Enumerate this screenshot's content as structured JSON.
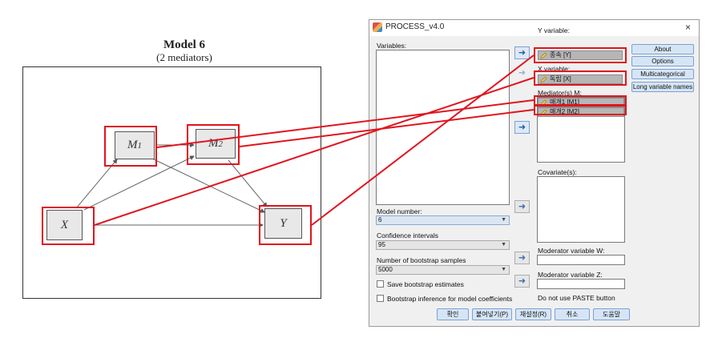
{
  "diagram": {
    "title": "Model 6",
    "subtitle": "(2 mediators)",
    "nodes": {
      "m1": {
        "base": "M",
        "sub": "1"
      },
      "m2": {
        "base": "M",
        "sub": "2"
      },
      "x": {
        "label": "X"
      },
      "y": {
        "label": "Y"
      }
    }
  },
  "dialog": {
    "title": "PROCESS_v4.0",
    "close_glyph": "×",
    "variables_label": "Variables:",
    "y_variable_label": "Y variable:",
    "y_variable_value": "종속 [Y]",
    "x_variable_label": "X variable:",
    "x_variable_value": "독립 [X]",
    "mediators_label": "Mediator(s) M:",
    "mediators": [
      "매개1 [M1]",
      "매개2 [M2]"
    ],
    "covariates_label": "Covariate(s):",
    "model_number_label": "Model number:",
    "model_number_value": "6",
    "confidence_label": "Confidence intervals",
    "confidence_value": "95",
    "bootstrap_label": "Number of bootstrap samples",
    "bootstrap_value": "5000",
    "save_bootstrap_label": "Save bootstrap estimates",
    "bootstrap_inference_label": "Bootstrap inference for model coefficients",
    "moderator_w_label": "Moderator variable W:",
    "moderator_z_label": "Moderator variable Z:",
    "paste_note": "Do not use PASTE button",
    "side_buttons": {
      "about": "About",
      "options": "Options",
      "multicategorical": "Multicategorical",
      "long_names": "Long variable names"
    },
    "bottom_buttons": {
      "ok": "확인",
      "paste": "붙여넣기(P)",
      "reset": "재설정(R)",
      "cancel": "취소",
      "help": "도움말"
    }
  },
  "colors": {
    "highlight": "#e0141e",
    "button_blue": "#d6e5f6"
  }
}
